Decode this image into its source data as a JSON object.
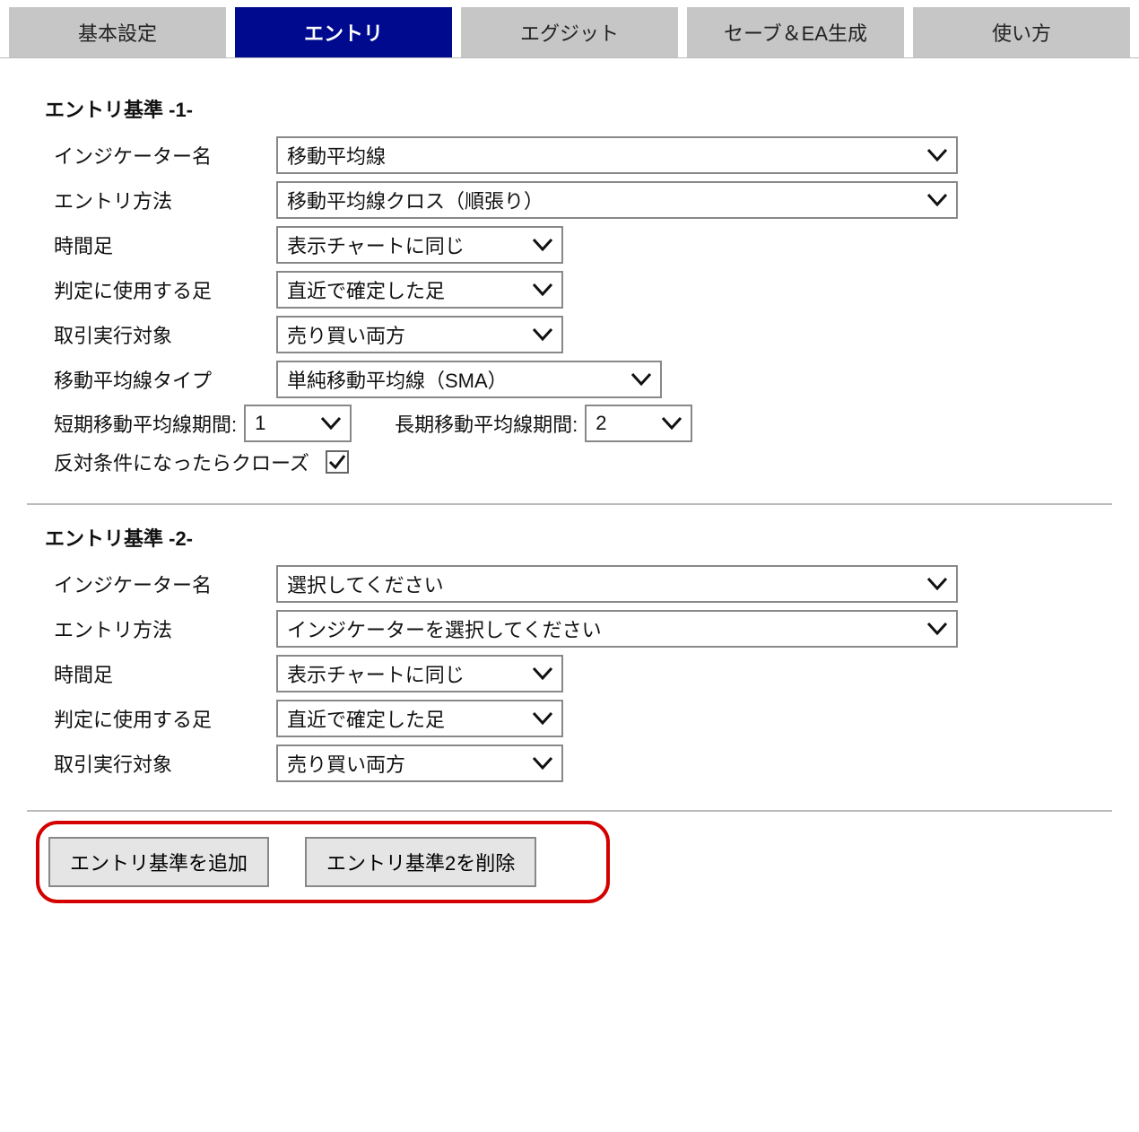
{
  "tabs": {
    "basic": "基本設定",
    "entry": "エントリ",
    "exit": "エグジット",
    "save": "セーブ＆EA生成",
    "usage": "使い方"
  },
  "sections": {
    "s1": {
      "title": "エントリ基準 -1-",
      "indicator_label": "インジケーター名",
      "indicator_value": "移動平均線",
      "method_label": "エントリ方法",
      "method_value": "移動平均線クロス（順張り）",
      "timeframe_label": "時間足",
      "timeframe_value": "表示チャートに同じ",
      "bar_label": "判定に使用する足",
      "bar_value": "直近で確定した足",
      "target_label": "取引実行対象",
      "target_value": "売り買い両方",
      "matype_label": "移動平均線タイプ",
      "matype_value": "単純移動平均線（SMA）",
      "short_label": "短期移動平均線期間:",
      "short_value": "1",
      "long_label": "長期移動平均線期間:",
      "long_value": "2",
      "close_label": "反対条件になったらクローズ",
      "close_checked": true
    },
    "s2": {
      "title": "エントリ基準 -2-",
      "indicator_label": "インジケーター名",
      "indicator_value": "選択してください",
      "method_label": "エントリ方法",
      "method_value": "インジケーターを選択してください",
      "timeframe_label": "時間足",
      "timeframe_value": "表示チャートに同じ",
      "bar_label": "判定に使用する足",
      "bar_value": "直近で確定した足",
      "target_label": "取引実行対象",
      "target_value": "売り買い両方"
    }
  },
  "buttons": {
    "add": "エントリ基準を追加",
    "delete": "エントリ基準2を削除"
  }
}
